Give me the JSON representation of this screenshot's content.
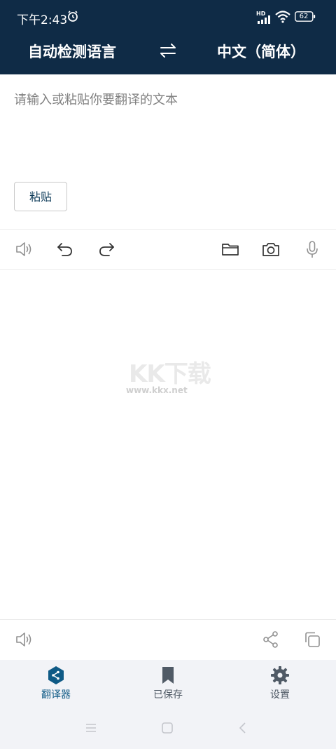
{
  "status_bar": {
    "time": "下午2:43",
    "network": "HD",
    "battery": "62"
  },
  "header": {
    "source_lang": "自动检测语言",
    "target_lang": "中文（简体）"
  },
  "input": {
    "placeholder": "请输入或粘贴你要翻译的文本",
    "paste_label": "粘贴"
  },
  "watermark": {
    "main": "KK下载",
    "url": "www.kkx.net"
  },
  "bottom_nav": {
    "items": [
      {
        "label": "翻译器",
        "active": true
      },
      {
        "label": "已保存",
        "active": false
      },
      {
        "label": "设置",
        "active": false
      }
    ]
  },
  "colors": {
    "header_bg": "#0f2b46",
    "active": "#0f5a86",
    "inactive": "#505a66",
    "icon_gray": "#909090",
    "icon_dark": "#333333"
  }
}
